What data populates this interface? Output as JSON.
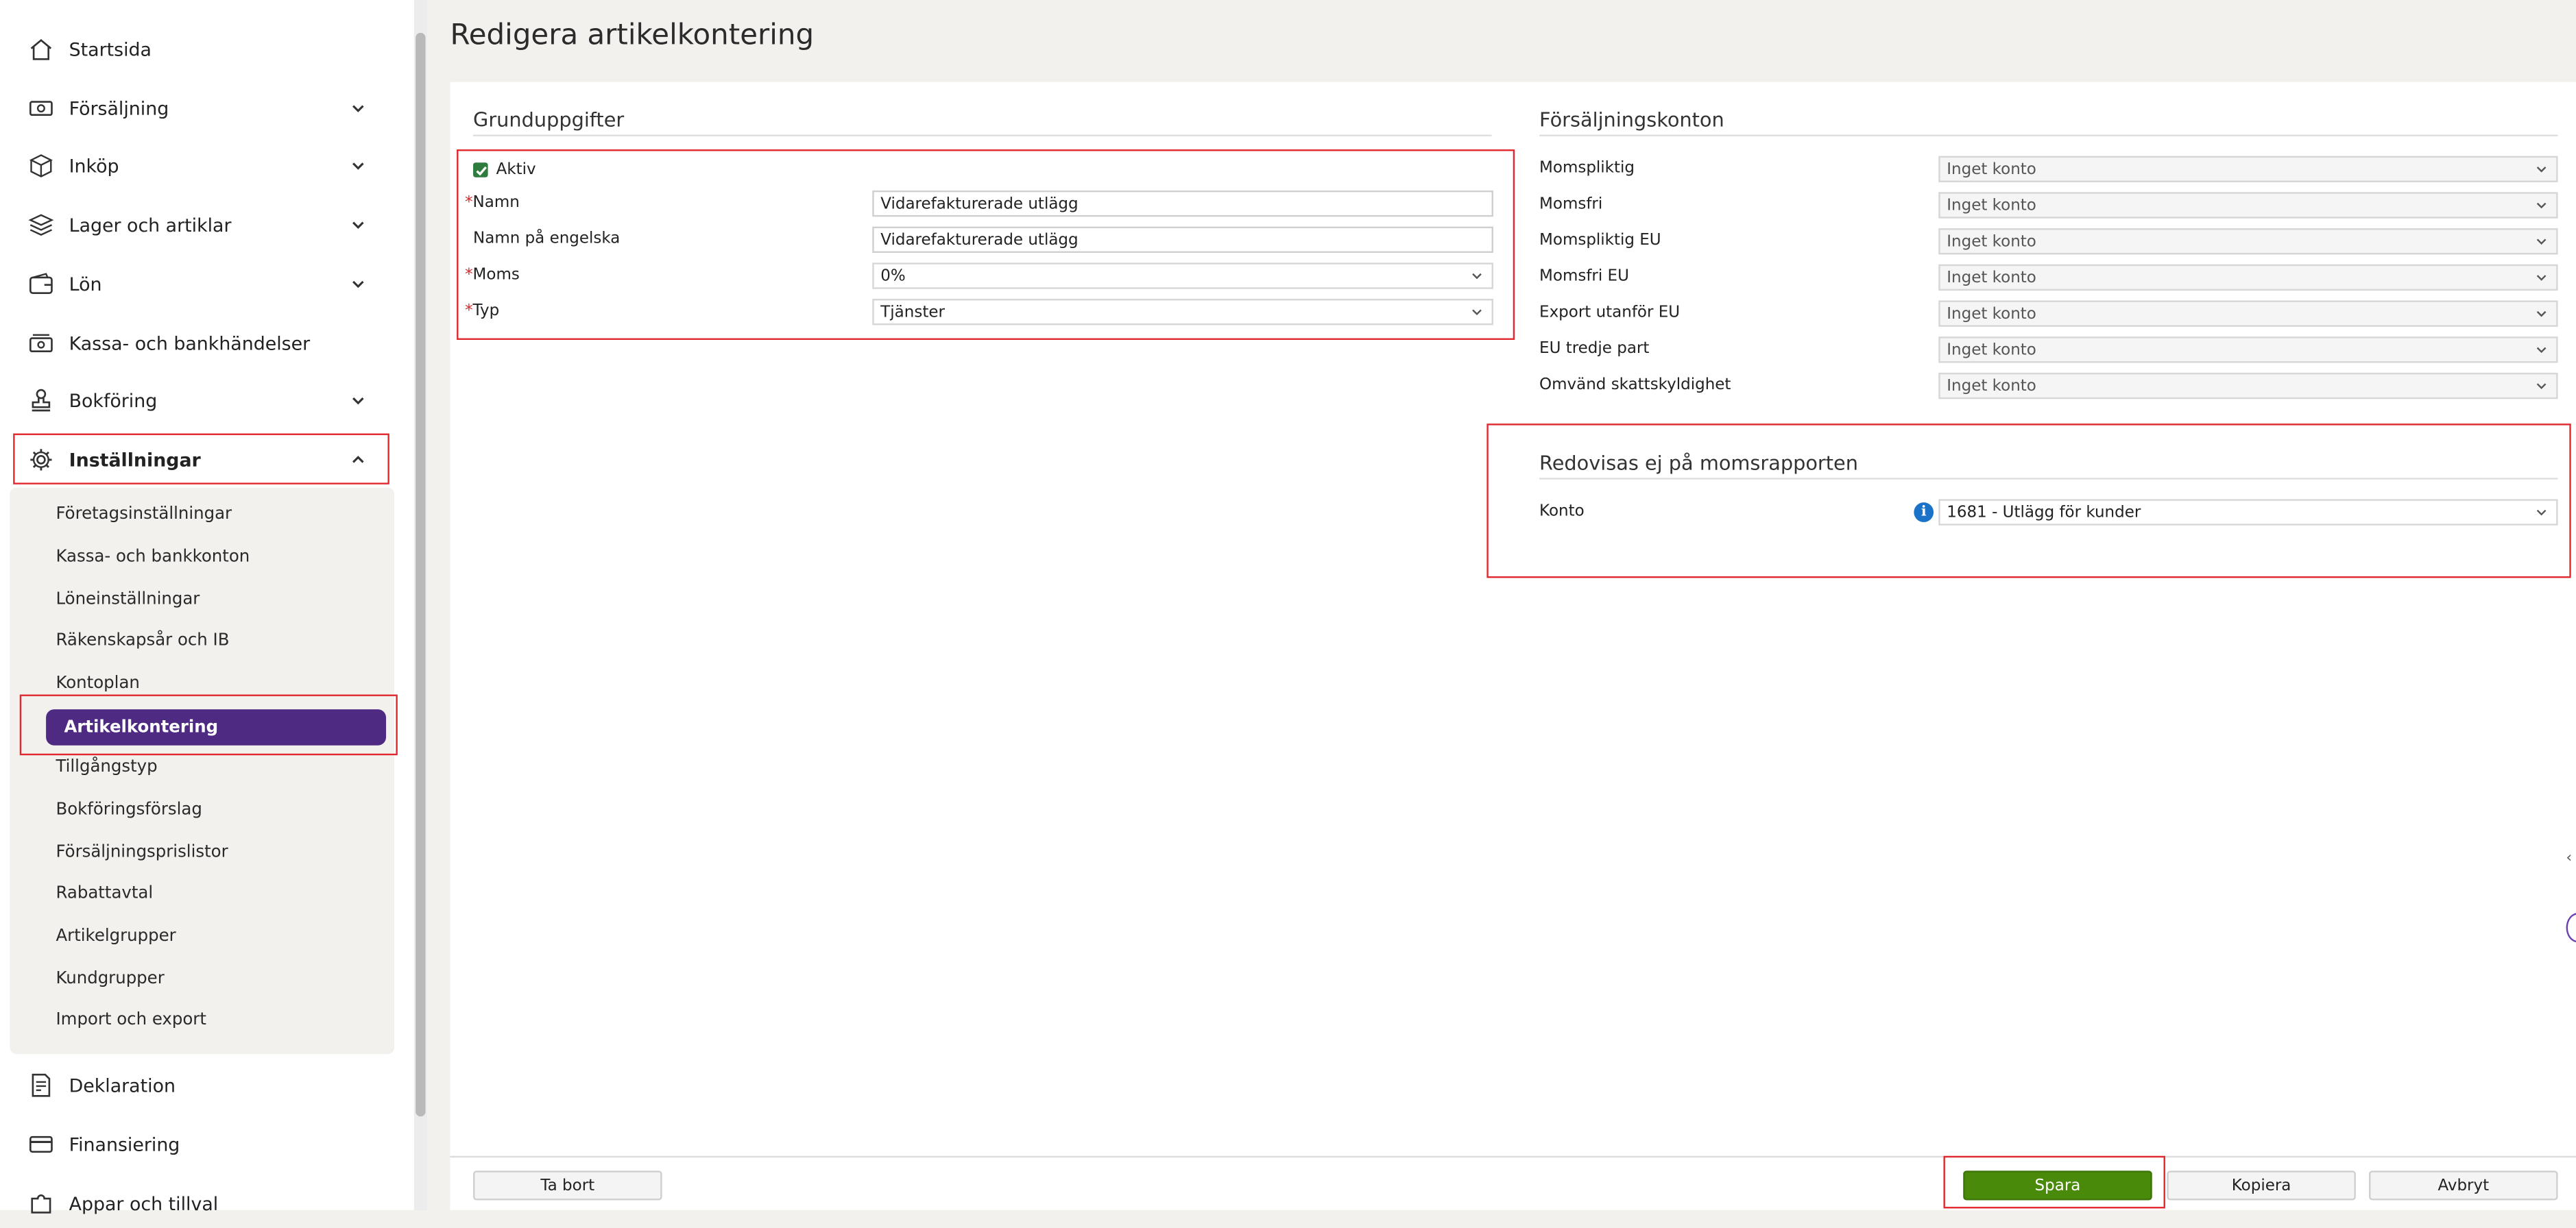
{
  "page": {
    "title": "Redigera artikelkontering"
  },
  "sidebar": {
    "items": [
      {
        "label": "Startsida",
        "icon": "home-icon",
        "chevron": false
      },
      {
        "label": "Försäljning",
        "icon": "money-icon",
        "chevron": true
      },
      {
        "label": "Inköp",
        "icon": "box-icon",
        "chevron": true
      },
      {
        "label": "Lager och artiklar",
        "icon": "layers-icon",
        "chevron": true
      },
      {
        "label": "Lön",
        "icon": "wallet-icon",
        "chevron": true
      },
      {
        "label": "Kassa- och bankhändelser",
        "icon": "cash-icon",
        "chevron": false
      },
      {
        "label": "Bokföring",
        "icon": "stamp-icon",
        "chevron": true
      },
      {
        "label": "Inställningar",
        "icon": "gear-icon",
        "chevron": true
      },
      {
        "label": "Deklaration",
        "icon": "document-icon",
        "chevron": false
      },
      {
        "label": "Finansiering",
        "icon": "card-icon",
        "chevron": false
      },
      {
        "label": "Appar och tillval",
        "icon": "puzzle-icon",
        "chevron": false
      }
    ],
    "sub_items": [
      "Företagsinställningar",
      "Kassa- och bankkonton",
      "Löneinställningar",
      "Räkenskapsår och IB",
      "Kontoplan",
      "Artikelkontering",
      "Tillgångstyp",
      "Bokföringsförslag",
      "Försäljningsprislistor",
      "Rabattavtal",
      "Artikelgrupper",
      "Kundgrupper",
      "Import och export"
    ]
  },
  "grund": {
    "heading": "Grunduppgifter",
    "aktiv_label": "Aktiv",
    "aktiv_checked": true,
    "namn_label": "Namn",
    "namn_value": "Vidarefakturerade utlägg",
    "namn_eng_label": "Namn på engelska",
    "namn_eng_value": "Vidarefakturerade utlägg",
    "moms_label": "Moms",
    "moms_value": "0%",
    "typ_label": "Typ",
    "typ_value": "Tjänster",
    "required_mark": "*"
  },
  "sales_accounts": {
    "heading": "Försäljningskonton",
    "rows": [
      {
        "label": "Momspliktig",
        "value": "Inget konto"
      },
      {
        "label": "Momsfri",
        "value": "Inget konto"
      },
      {
        "label": "Momspliktig EU",
        "value": "Inget konto"
      },
      {
        "label": "Momsfri EU",
        "value": "Inget konto"
      },
      {
        "label": "Export utanför EU",
        "value": "Inget konto"
      },
      {
        "label": "EU tredje part",
        "value": "Inget konto"
      },
      {
        "label": "Omvänd skattskyldighet",
        "value": "Inget konto"
      }
    ]
  },
  "vat_report": {
    "heading": "Redovisas ej på momsrapporten",
    "konto_label": "Konto",
    "konto_value": "1681 - Utlägg för kunder",
    "info_glyph": "i"
  },
  "footer": {
    "delete_label": "Ta bort",
    "save_label": "Spara",
    "copy_label": "Kopiera",
    "cancel_label": "Avbryt"
  },
  "colors": {
    "accent_purple": "#4f2a83",
    "save_green": "#4a8a0a",
    "highlight_red": "#e0282e",
    "check_green": "#2e7d3e",
    "info_blue": "#1a73c8"
  }
}
